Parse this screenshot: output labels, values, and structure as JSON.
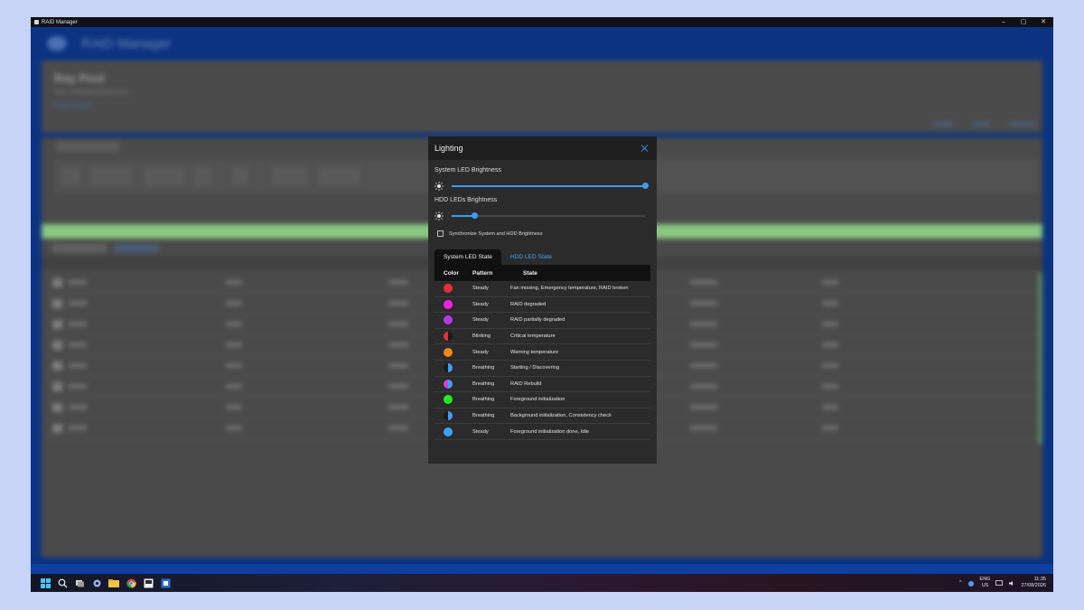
{
  "window": {
    "title": "RAID Manager",
    "controls": [
      "–",
      "▢",
      "✕"
    ]
  },
  "background_app": {
    "app_name": "RAID Manager",
    "hero_title": "Ray Pool",
    "hero_sub": "Ikon Internal Enclosure",
    "hero_link": "Find Device"
  },
  "dialog": {
    "title": "Lighting",
    "system_brightness_label": "System LED Brightness",
    "system_brightness_value": 1.0,
    "hdd_brightness_label": "HDD LEDs Brightness",
    "hdd_brightness_value": 0.12,
    "sync_label": "Synchronize System and HDD Brightness",
    "sync_checked": false,
    "tabs": [
      {
        "label": "System LED State",
        "active": true
      },
      {
        "label": "HDD LED State",
        "active": false
      }
    ],
    "table": {
      "headers": [
        "Color",
        "Pattern",
        "State"
      ],
      "rows": [
        {
          "color": "#e8303a",
          "color2": null,
          "pattern": "Steady",
          "state": "Fan missing, Emergency temperature, RAID broken"
        },
        {
          "color": "#ff20e8",
          "color2": null,
          "pattern": "Steady",
          "state": "RAID degraded"
        },
        {
          "color": "#b838e8",
          "color2": null,
          "pattern": "Steady",
          "state": "RAID partially degraded"
        },
        {
          "color": "#e8303a",
          "color2": "#1a1a1a",
          "pattern": "Blinking",
          "state": "Critical temperature"
        },
        {
          "color": "#f28a18",
          "color2": null,
          "pattern": "Steady",
          "state": "Warning temperature"
        },
        {
          "color": "#3fa0ff",
          "color2": "#1a1a1a",
          "pattern": "Breathing",
          "state": "Starting / Discovering"
        },
        {
          "color": "#3fa0ff",
          "color2": "#d23fe0",
          "pattern": "Breathing",
          "state": "RAID Rebuild"
        },
        {
          "color": "#22ee22",
          "color2": null,
          "pattern": "Breathing",
          "state": "Foreground initialization"
        },
        {
          "color": "#3fa0ff",
          "color2": "#1a1a1a",
          "pattern": "Breathing",
          "state": "Background initialization, Consistency check"
        },
        {
          "color": "#3fa0ff",
          "color2": null,
          "pattern": "Steady",
          "state": "Foreground initialization done, Idle"
        }
      ]
    }
  },
  "taskbar": {
    "icons": [
      "windows-start-icon",
      "search-icon",
      "task-view-icon",
      "settings-icon",
      "file-explorer-icon",
      "chrome-icon",
      "raid-manager-icon",
      "store-icon"
    ],
    "lang_top": "ENG",
    "lang_bottom": "US",
    "time": "11:35",
    "date": "27/08/2026"
  },
  "colors": {
    "accent": "#3b9ded",
    "dialog_bg": "#2b2b2b",
    "window_frame": "#0e3f9e"
  }
}
